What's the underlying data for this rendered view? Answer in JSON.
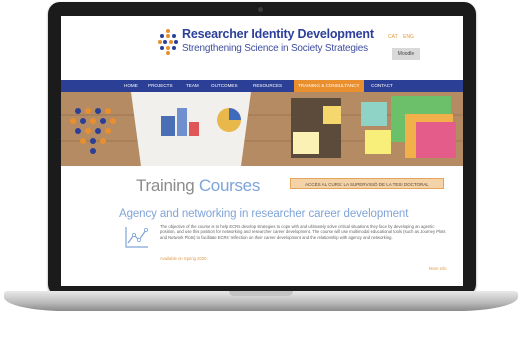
{
  "site": {
    "title": "Researcher Identity Development",
    "subtitle": "Strengthening Science in Society Strategies",
    "languages": [
      "CAT",
      "ENG"
    ],
    "moodle_label": "Moodle"
  },
  "nav": {
    "items": [
      "HOME",
      "PROJECTS",
      "TEAM",
      "OUTCOMES",
      "RESOURCES",
      "TRAINING & CONSULTANCY",
      "CONTACT"
    ],
    "active_index": 5
  },
  "page": {
    "heading_main": "Training",
    "heading_accent": "Courses",
    "cta_label": "ACCÉS AL CURS: LA SUPERVISIÓ DE LA TESI DOCTORAL"
  },
  "course": {
    "title": "Agency and networking in researcher career development",
    "description": "The objective of the course is to help ECRs develop strategies to cope with and ultimately solve critical situations they face by developing an agentic position, and use this position for networking and researcher career development. The course will use multimodal educational tools (such as Journey Plots and Network Plots) to facilitate ECRs' reflection on their career development and the relationship with agency and networking.",
    "availability": "Available on Spring 2020.",
    "more_info_label": "More info"
  },
  "icons": {
    "logo": "dotted-grid-logo",
    "course": "line-chart-icon",
    "camera": "camera-icon"
  },
  "colors": {
    "brand_blue": "#2c3f96",
    "accent_orange": "#e98f2d",
    "heading_light_blue": "#7fa4d8"
  }
}
